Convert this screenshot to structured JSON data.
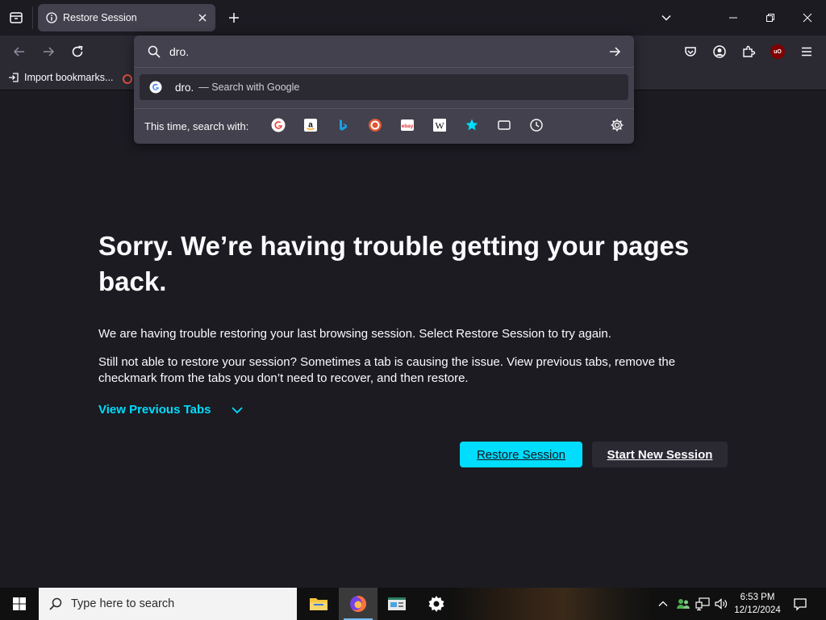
{
  "tab": {
    "title": "Restore Session"
  },
  "urlbar": {
    "value": "dro.",
    "suggestion": {
      "query": "dro.",
      "action": "— Search with Google"
    },
    "oneoff_label": "This time, search with:",
    "engines": [
      "Google",
      "Amazon",
      "Bing",
      "DuckDuckGo",
      "eBay",
      "Wikipedia",
      "Bookmarks",
      "Tabs",
      "History"
    ],
    "ebay_glyph": "ebay",
    "wiki_glyph": "W"
  },
  "bookmarks": {
    "import_label": "Import bookmarks..."
  },
  "extensions": {
    "ublock_badge": "uO"
  },
  "content": {
    "title": "Sorry. We’re having trouble getting your pages back.",
    "desc1": "We are having trouble restoring your last browsing session. Select Restore Session to try again.",
    "desc2": "Still not able to restore your session? Sometimes a tab is causing the issue. View previous tabs, remove the checkmark from the tabs you don’t need to recover, and then restore.",
    "view_previous": "View Previous Tabs",
    "restore_button": "Restore Session",
    "start_new_button": "Start New Session"
  },
  "taskbar": {
    "search_placeholder": "Type here to search",
    "time": "6:53 PM",
    "date": "12/12/2024"
  },
  "colors": {
    "accent": "#00ddff",
    "page_bg": "#1c1b22",
    "toolbar_bg": "#2b2a33",
    "popup_bg": "#42414d"
  }
}
